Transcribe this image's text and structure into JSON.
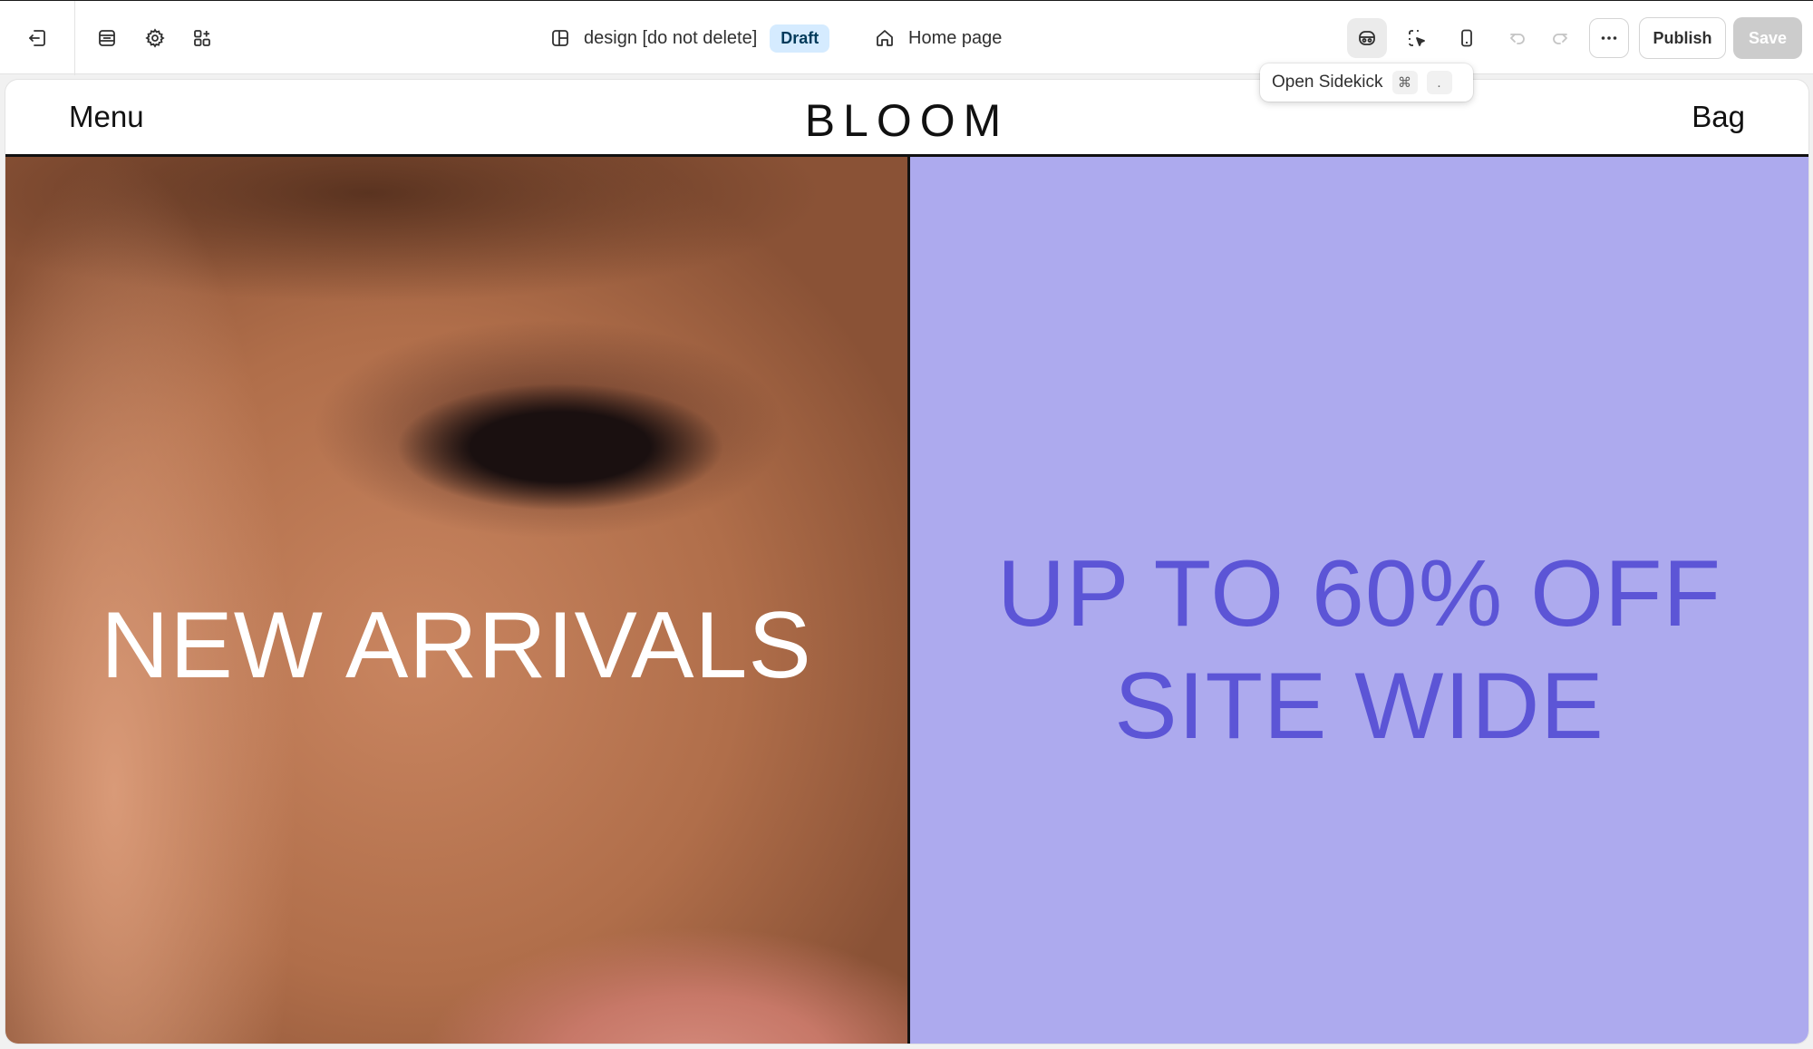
{
  "toolbar": {
    "theme_name": "design [do not delete]",
    "theme_status": "Draft",
    "page_name": "Home page",
    "publish_label": "Publish",
    "save_label": "Save",
    "icons": [
      "exit-icon",
      "sections-icon",
      "settings-icon",
      "apps-icon",
      "layout-icon",
      "home-icon",
      "sidekick-icon",
      "inspector-icon",
      "mobile-preview-icon",
      "undo-icon",
      "redo-icon",
      "more-icon"
    ]
  },
  "tooltip": {
    "label": "Open Sidekick",
    "key_modifier": "⌘",
    "key": "."
  },
  "store": {
    "menu_label": "Menu",
    "logo": "BLOOM",
    "bag_label": "Bag",
    "hero_left_title": "NEW ARRIVALS",
    "hero_right_line1": "UP TO 60% OFF",
    "hero_right_line2": "SITE WIDE"
  },
  "colors": {
    "hero_right_bg": "#adaaee",
    "hero_right_text": "#5c55d6",
    "draft_badge_bg": "#d5ebff",
    "save_disabled_bg": "#cccccc"
  }
}
